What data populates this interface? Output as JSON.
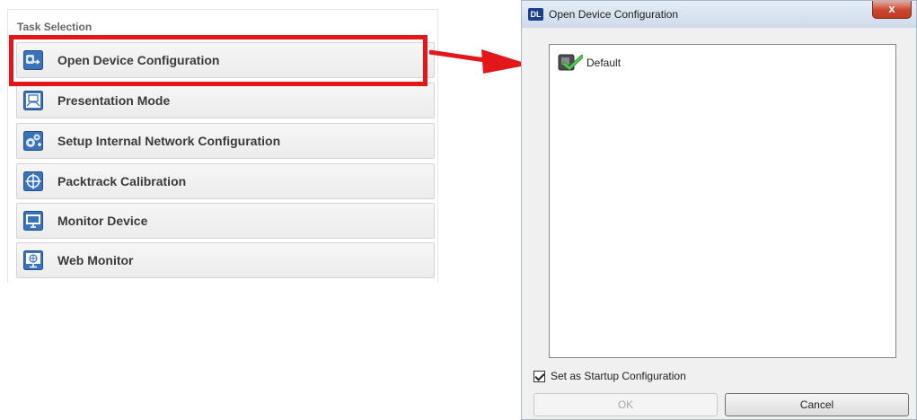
{
  "task_panel": {
    "title": "Task Selection",
    "items": [
      {
        "label": "Open Device Configuration",
        "icon": "open-device-config-icon",
        "highlighted": true
      },
      {
        "label": "Presentation Mode",
        "icon": "presentation-mode-icon"
      },
      {
        "label": "Setup Internal Network Configuration",
        "icon": "network-config-icon"
      },
      {
        "label": "Packtrack Calibration",
        "icon": "crosshair-icon"
      },
      {
        "label": "Monitor Device",
        "icon": "monitor-icon"
      },
      {
        "label": "Web Monitor",
        "icon": "web-monitor-icon"
      }
    ]
  },
  "dialog": {
    "app_icon_text": "DL",
    "title": "Open Device Configuration",
    "close_label": "x",
    "configurations": [
      {
        "label": "Default",
        "icon": "default-config-icon"
      }
    ],
    "startup_checkbox": {
      "label": "Set as Startup Configuration",
      "checked": true
    },
    "ok_label": "OK",
    "ok_enabled": false,
    "cancel_label": "Cancel"
  },
  "colors": {
    "highlight": "#e3161a",
    "icon_blue": "#3a73b9"
  }
}
